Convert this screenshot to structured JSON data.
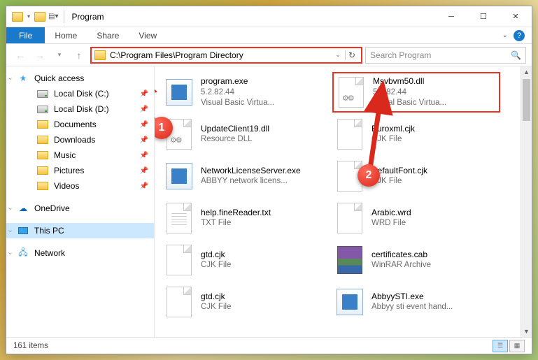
{
  "window": {
    "title": "Program"
  },
  "ribbon": {
    "file": "File",
    "tabs": [
      "Home",
      "Share",
      "View"
    ]
  },
  "address": {
    "path": "C:\\Program Files\\Program Directory"
  },
  "search": {
    "placeholder": "Search Program"
  },
  "sidebar": {
    "quick_access": "Quick access",
    "items": [
      {
        "label": "Local Disk (C:)",
        "kind": "drive"
      },
      {
        "label": "Local Disk (D:)",
        "kind": "drive"
      },
      {
        "label": "Documents",
        "kind": "folder"
      },
      {
        "label": "Downloads",
        "kind": "folder"
      },
      {
        "label": "Music",
        "kind": "folder"
      },
      {
        "label": "Pictures",
        "kind": "folder"
      },
      {
        "label": "Videos",
        "kind": "folder"
      }
    ],
    "onedrive": "OneDrive",
    "thispc": "This PC",
    "network": "Network"
  },
  "files": {
    "left": [
      {
        "name": "program.exe",
        "line2": "5.2.82.44",
        "line3": "Visual Basic Virtua...",
        "icon": "app"
      },
      {
        "name": "UpdateClient19.dll",
        "line2": "Resource DLL",
        "line3": "",
        "icon": "gear"
      },
      {
        "name": "NetworkLicenseServer.exe",
        "line2": "ABBYY network licens...",
        "line3": "",
        "icon": "app"
      },
      {
        "name": "help.fineReader.txt",
        "line2": "TXT File",
        "line3": "",
        "icon": "lines"
      },
      {
        "name": "gtd.cjk",
        "line2": "CJK File",
        "line3": "",
        "icon": "blank"
      },
      {
        "name": "gtd.cjk",
        "line2": "CJK File",
        "line3": "",
        "icon": "blank"
      }
    ],
    "right": [
      {
        "name": "Msvbvm50.dll",
        "line2": "5.2.82.44",
        "line3": "Visual Basic Virtua...",
        "icon": "gear",
        "highlight": true
      },
      {
        "name": "Euroxml.cjk",
        "line2": "CJK File",
        "line3": "",
        "icon": "blank"
      },
      {
        "name": "DefaultFont.cjk",
        "line2": "CJK File",
        "line3": "",
        "icon": "blank"
      },
      {
        "name": "Arabic.wrd",
        "line2": "WRD File",
        "line3": "",
        "icon": "blank"
      },
      {
        "name": "certificates.cab",
        "line2": "WinRAR Archive",
        "line3": "",
        "icon": "rar"
      },
      {
        "name": "AbbyySTI.exe",
        "line2": "Abbyy sti event hand...",
        "line3": "",
        "icon": "app"
      }
    ]
  },
  "status": {
    "count": "161 items"
  },
  "annotations": {
    "step1": "1",
    "step2": "2"
  }
}
